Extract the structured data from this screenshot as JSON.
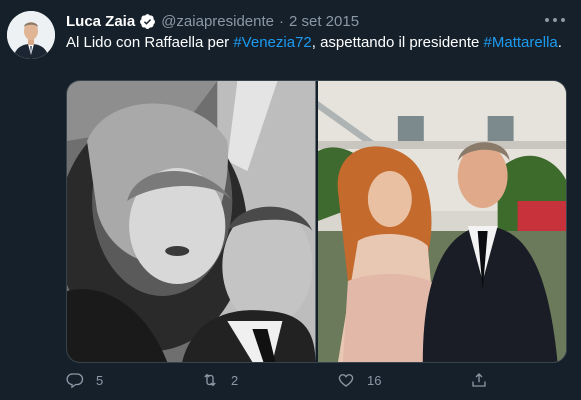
{
  "tweet": {
    "author": {
      "name": "Luca Zaia",
      "handle": "@zaiapresidente",
      "verified_icon": "verified-badge-icon",
      "avatar_icon": "profile-avatar"
    },
    "separator": "·",
    "date": "2 set 2015",
    "text": {
      "part1": "Al Lido con Raffaella per ",
      "hashtag1": "#Venezia72",
      "part2": ", aspettando il presidente ",
      "hashtag2": "#Mattarella",
      "part3": "."
    },
    "media": [
      {
        "type": "photo",
        "style": "black-and-white selfie"
      },
      {
        "type": "photo",
        "style": "color portrait"
      }
    ],
    "actions": {
      "reply": {
        "icon": "reply-icon",
        "count": "5"
      },
      "retweet": {
        "icon": "retweet-icon",
        "count": "2"
      },
      "like": {
        "icon": "heart-icon",
        "count": "16"
      },
      "share": {
        "icon": "share-icon"
      }
    }
  },
  "colors": {
    "background": "#15202b",
    "accent": "#1d9bf0",
    "secondary_text": "#8b98a5"
  }
}
